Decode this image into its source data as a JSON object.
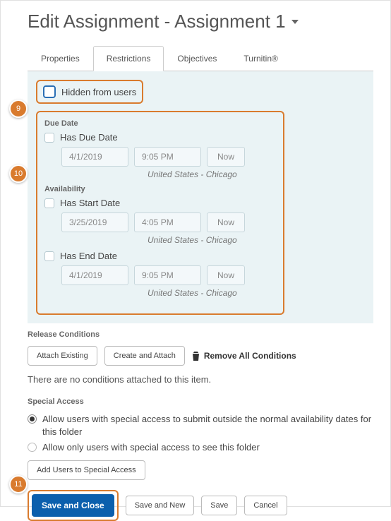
{
  "header": {
    "title": "Edit Assignment - Assignment 1"
  },
  "tabs": {
    "properties": "Properties",
    "restrictions": "Restrictions",
    "objectives": "Objectives",
    "turnitin": "Turnitin®"
  },
  "hidden": {
    "label": "Hidden from users"
  },
  "dueDate": {
    "section": "Due Date",
    "hasLabel": "Has Due Date",
    "date": "4/1/2019",
    "time": "9:05 PM",
    "now": "Now",
    "tz": "United States - Chicago"
  },
  "availability": {
    "section": "Availability",
    "start": {
      "hasLabel": "Has Start Date",
      "date": "3/25/2019",
      "time": "4:05 PM",
      "now": "Now",
      "tz": "United States - Chicago"
    },
    "end": {
      "hasLabel": "Has End Date",
      "date": "4/1/2019",
      "time": "9:05 PM",
      "now": "Now",
      "tz": "United States - Chicago"
    }
  },
  "release": {
    "section": "Release Conditions",
    "attach": "Attach Existing",
    "create": "Create and Attach",
    "removeAll": "Remove All Conditions",
    "empty": "There are no conditions attached to this item."
  },
  "special": {
    "section": "Special Access",
    "opt1": "Allow users with special access to submit outside the normal availability dates for this folder",
    "opt2": "Allow only users with special access to see this folder",
    "addBtn": "Add Users to Special Access"
  },
  "footer": {
    "saveClose": "Save and Close",
    "saveNew": "Save and New",
    "save": "Save",
    "cancel": "Cancel"
  },
  "callouts": {
    "b9": "9",
    "b10": "10",
    "b11": "11"
  }
}
